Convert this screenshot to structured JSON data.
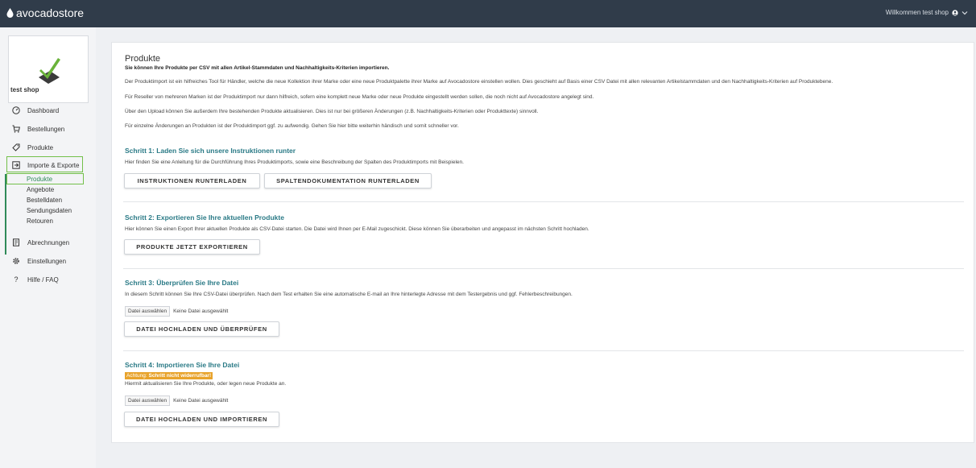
{
  "topbar": {
    "brand": "avocadostore",
    "welcome": "Willkommen test shop",
    "accent_color": "#303c4a"
  },
  "sidebar": {
    "shop_name": "test shop",
    "items": [
      {
        "label": "Dashboard",
        "icon": "speedometer-icon"
      },
      {
        "label": "Bestellungen",
        "icon": "cart-icon"
      },
      {
        "label": "Produkte",
        "icon": "tag-icon"
      },
      {
        "label": "Importe & Exporte",
        "icon": "import-icon"
      },
      {
        "label": "Abrechnungen",
        "icon": "invoice-icon"
      },
      {
        "label": "Einstellungen",
        "icon": "gear-icon"
      },
      {
        "label": "Hilfe / FAQ",
        "icon": "question-icon"
      }
    ],
    "subitems": [
      "Produkte",
      "Angebote",
      "Bestelldaten",
      "Sendungsdaten",
      "Retouren"
    ],
    "highlight_color": "#73c04a"
  },
  "main": {
    "title": "Produkte",
    "subtitle": "Sie können Ihre Produkte per CSV mit allen Artikel-Stammdaten und Nachhaltigkeits-Kriterien importieren.",
    "paragraphs": [
      "Der Produktimport ist ein hilfreiches Tool für Händler, welche die neue Kollektion ihrer Marke oder eine neue Produktpalette ihrer Marke auf Avocadostore einstellen wollen. Dies geschieht auf Basis einer CSV Datei mit allen relevanten Artikelstammdaten und den Nachhaltigkeits-Kriterien auf Produktebene.",
      "Für Reseller von mehreren Marken ist der Produktimport nur dann hilfreich, sofern eine komplett neue Marke oder neue Produkte eingestellt werden sollen, die noch nicht auf Avocadostore angelegt sind.",
      "Über den Upload können Sie außerdem Ihre bestehenden Produkte aktualisieren. Dies ist nur bei größeren Änderungen (z.B. Nachhaltigkeits-Kriterien oder Produkttexte) sinnvoll.",
      "Für einzelne Änderungen an Produkten ist der Produktimport ggf. zu aufwendig. Gehen Sie hier bitte weiterhin händisch und somit schneller vor."
    ],
    "step1": {
      "title": "Schritt 1: Laden Sie sich unsere Instruktionen runter",
      "desc": "Hier finden Sie eine Anleitung für die Durchführung Ihres Produktimports, sowie eine Beschreibung der Spalten des Produktimports mit Beispielen.",
      "btn1": "INSTRUKTIONEN RUNTERLADEN",
      "btn2": "SPALTENDOKUMENTATION RUNTERLADEN"
    },
    "step2": {
      "title": "Schritt 2: Exportieren Sie Ihre aktuellen Produkte",
      "desc": "Hier können Sie einen Export Ihrer aktuellen Produkte als CSV-Datei starten. Die Datei wird Ihnen per E-Mail zugeschickt. Diese können Sie überarbeiten und angepasst im nächsten Schritt hochladen.",
      "btn": "PRODUKTE JETZT EXPORTIEREN"
    },
    "step3": {
      "title": "Schritt 3: Überprüfen Sie Ihre Datei",
      "desc": "In diesem Schritt können Sie Ihre CSV-Datei überprüfen. Nach dem Test erhalten Sie eine automatische E-mail an Ihre hinterlegte Adresse mit dem Testergebnis und ggf. Fehlerbeschreibungen.",
      "file_btn": "Datei auswählen",
      "file_status": "Keine Datei ausgewählt",
      "btn": "DATEI HOCHLADEN UND ÜBERPRÜFEN"
    },
    "step4": {
      "title": "Schritt 4: Importieren Sie Ihre Datei",
      "warning_prefix": "Achtung:",
      "warning_bold": "Schritt nicht widerrufbar!",
      "desc": "Hiermit aktualisieren Sie Ihre Produkte, oder legen neue Produkte an.",
      "file_btn": "Datei auswählen",
      "file_status": "Keine Datei ausgewählt",
      "btn": "DATEI HOCHLADEN UND IMPORTIEREN"
    }
  }
}
